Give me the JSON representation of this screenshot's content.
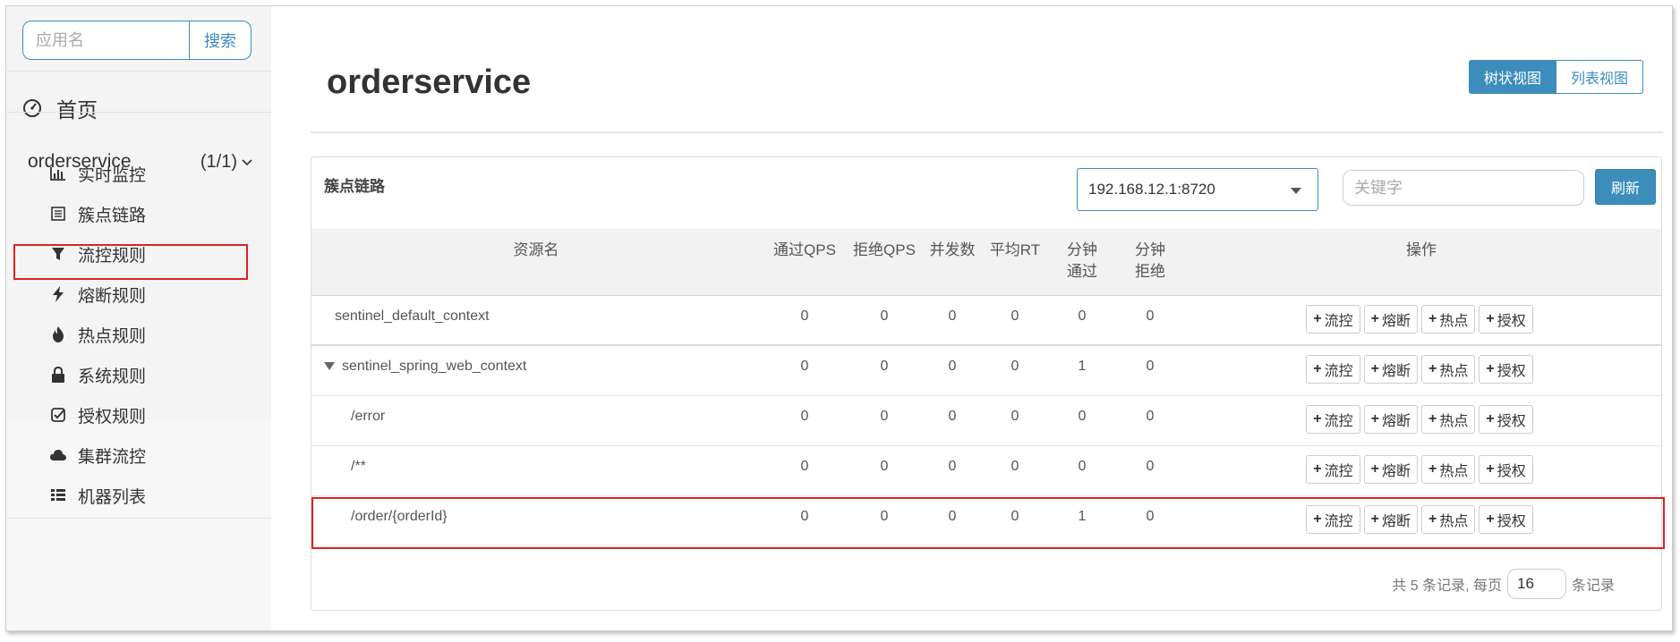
{
  "sidebar": {
    "search": {
      "placeholder": "应用名",
      "button": "搜索"
    },
    "home": {
      "label": "首页",
      "icon": "dashboard-icon"
    },
    "app": {
      "name": "orderservice",
      "count": "(1/1)"
    },
    "items": [
      {
        "label": "实时监控",
        "icon": "bar-chart-icon"
      },
      {
        "label": "簇点链路",
        "icon": "list-icon",
        "selected": true
      },
      {
        "label": "流控规则",
        "icon": "filter-icon"
      },
      {
        "label": "熔断规则",
        "icon": "flash-icon"
      },
      {
        "label": "热点规则",
        "icon": "fire-icon"
      },
      {
        "label": "系统规则",
        "icon": "lock-icon"
      },
      {
        "label": "授权规则",
        "icon": "check-square-icon"
      },
      {
        "label": "集群流控",
        "icon": "cloud-icon"
      },
      {
        "label": "机器列表",
        "icon": "th-list-icon"
      }
    ]
  },
  "main": {
    "title": "orderservice",
    "view_toggle": {
      "tree": "树状视图",
      "list": "列表视图",
      "active": "tree"
    },
    "panel": {
      "title": "簇点链路",
      "machine": "192.168.12.1:8720",
      "keyword_placeholder": "关键字",
      "refresh": "刷新"
    },
    "table": {
      "headers": [
        "资源名",
        "通过QPS",
        "拒绝QPS",
        "并发数",
        "平均RT",
        "分钟通过",
        "分钟拒绝",
        "操作"
      ],
      "rows": [
        {
          "name": "sentinel_default_context",
          "pass_qps": "0",
          "block_qps": "0",
          "threads": "0",
          "avg_rt": "0",
          "minute_pass": "0",
          "minute_block": "0"
        },
        {
          "name": "sentinel_spring_web_context",
          "pass_qps": "0",
          "block_qps": "0",
          "threads": "0",
          "avg_rt": "0",
          "minute_pass": "1",
          "minute_block": "0",
          "expanded": true
        },
        {
          "name": "/error",
          "pass_qps": "0",
          "block_qps": "0",
          "threads": "0",
          "avg_rt": "0",
          "minute_pass": "0",
          "minute_block": "0"
        },
        {
          "name": "/**",
          "pass_qps": "0",
          "block_qps": "0",
          "threads": "0",
          "avg_rt": "0",
          "minute_pass": "0",
          "minute_block": "0"
        },
        {
          "name": "/order/{orderId}",
          "pass_qps": "0",
          "block_qps": "0",
          "threads": "0",
          "avg_rt": "0",
          "minute_pass": "1",
          "minute_block": "0",
          "highlighted": true
        }
      ],
      "actions": [
        "流控",
        "熔断",
        "热点",
        "授权"
      ]
    },
    "pager": {
      "total_text": "共 5 条记录, 每页",
      "page_size": "16",
      "suffix": "条记录"
    }
  },
  "colors": {
    "accent": "#3c8dbc",
    "highlight": "#e02020"
  }
}
